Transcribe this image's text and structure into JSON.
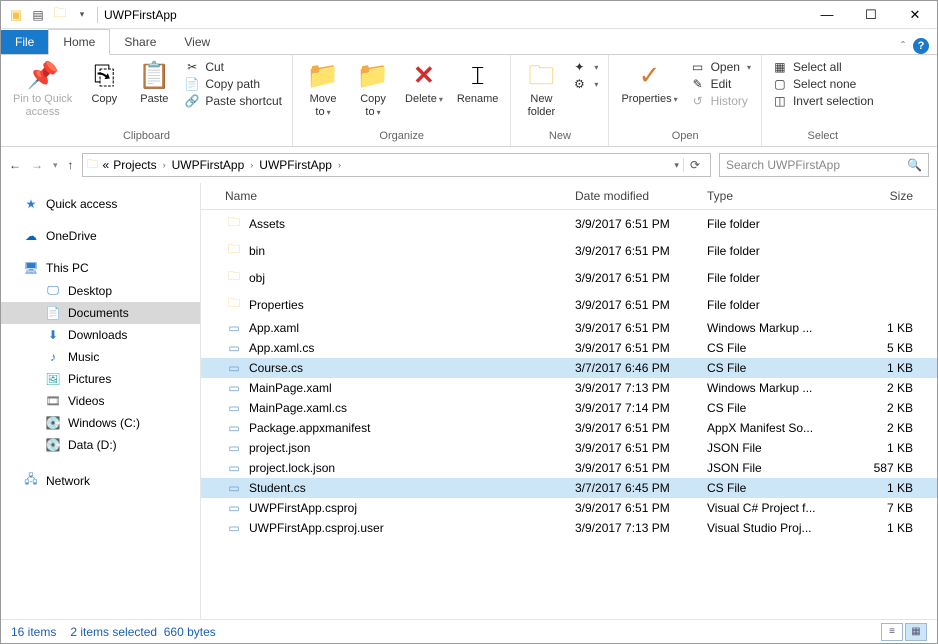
{
  "title": "UWPFirstApp",
  "tabs": {
    "file": "File",
    "home": "Home",
    "share": "Share",
    "view": "View"
  },
  "ribbon": {
    "clipboard": {
      "label": "Clipboard",
      "pin": "Pin to Quick\naccess",
      "copy": "Copy",
      "paste": "Paste",
      "cut": "Cut",
      "copypath": "Copy path",
      "shortcut": "Paste shortcut"
    },
    "organize": {
      "label": "Organize",
      "move": "Move\nto",
      "copyto": "Copy\nto",
      "delete": "Delete",
      "rename": "Rename"
    },
    "new": {
      "label": "New",
      "folder": "New\nfolder"
    },
    "open_g": {
      "label": "Open",
      "props": "Properties",
      "open": "Open",
      "edit": "Edit",
      "history": "History"
    },
    "select": {
      "label": "Select",
      "all": "Select all",
      "none": "Select none",
      "invert": "Invert selection"
    }
  },
  "address": {
    "segments": [
      "Projects",
      "UWPFirstApp",
      "UWPFirstApp"
    ],
    "prefix": "«"
  },
  "search": {
    "placeholder": "Search UWPFirstApp"
  },
  "nav": {
    "quick": "Quick access",
    "onedrive": "OneDrive",
    "thispc": "This PC",
    "items": [
      "Desktop",
      "Documents",
      "Downloads",
      "Music",
      "Pictures",
      "Videos",
      "Windows (C:)",
      "Data (D:)"
    ],
    "network": "Network"
  },
  "columns": {
    "name": "Name",
    "date": "Date modified",
    "type": "Type",
    "size": "Size"
  },
  "files": [
    {
      "name": "Assets",
      "date": "3/9/2017 6:51 PM",
      "type": "File folder",
      "size": "",
      "ico": "folder"
    },
    {
      "name": "bin",
      "date": "3/9/2017 6:51 PM",
      "type": "File folder",
      "size": "",
      "ico": "folder"
    },
    {
      "name": "obj",
      "date": "3/9/2017 6:51 PM",
      "type": "File folder",
      "size": "",
      "ico": "folder"
    },
    {
      "name": "Properties",
      "date": "3/9/2017 6:51 PM",
      "type": "File folder",
      "size": "",
      "ico": "folder"
    },
    {
      "name": "App.xaml",
      "date": "3/9/2017 6:51 PM",
      "type": "Windows Markup ...",
      "size": "1 KB",
      "ico": "file"
    },
    {
      "name": "App.xaml.cs",
      "date": "3/9/2017 6:51 PM",
      "type": "CS File",
      "size": "5 KB",
      "ico": "file"
    },
    {
      "name": "Course.cs",
      "date": "3/7/2017 6:46 PM",
      "type": "CS File",
      "size": "1 KB",
      "ico": "file",
      "sel": true
    },
    {
      "name": "MainPage.xaml",
      "date": "3/9/2017 7:13 PM",
      "type": "Windows Markup ...",
      "size": "2 KB",
      "ico": "file"
    },
    {
      "name": "MainPage.xaml.cs",
      "date": "3/9/2017 7:14 PM",
      "type": "CS File",
      "size": "2 KB",
      "ico": "file"
    },
    {
      "name": "Package.appxmanifest",
      "date": "3/9/2017 6:51 PM",
      "type": "AppX Manifest So...",
      "size": "2 KB",
      "ico": "file"
    },
    {
      "name": "project.json",
      "date": "3/9/2017 6:51 PM",
      "type": "JSON File",
      "size": "1 KB",
      "ico": "file"
    },
    {
      "name": "project.lock.json",
      "date": "3/9/2017 6:51 PM",
      "type": "JSON File",
      "size": "587 KB",
      "ico": "file"
    },
    {
      "name": "Student.cs",
      "date": "3/7/2017 6:45 PM",
      "type": "CS File",
      "size": "1 KB",
      "ico": "file",
      "sel": true
    },
    {
      "name": "UWPFirstApp.csproj",
      "date": "3/9/2017 6:51 PM",
      "type": "Visual C# Project f...",
      "size": "7 KB",
      "ico": "file"
    },
    {
      "name": "UWPFirstApp.csproj.user",
      "date": "3/9/2017 7:13 PM",
      "type": "Visual Studio Proj...",
      "size": "1 KB",
      "ico": "file"
    }
  ],
  "status": {
    "count": "16 items",
    "sel": "2 items selected",
    "bytes": "660 bytes"
  }
}
